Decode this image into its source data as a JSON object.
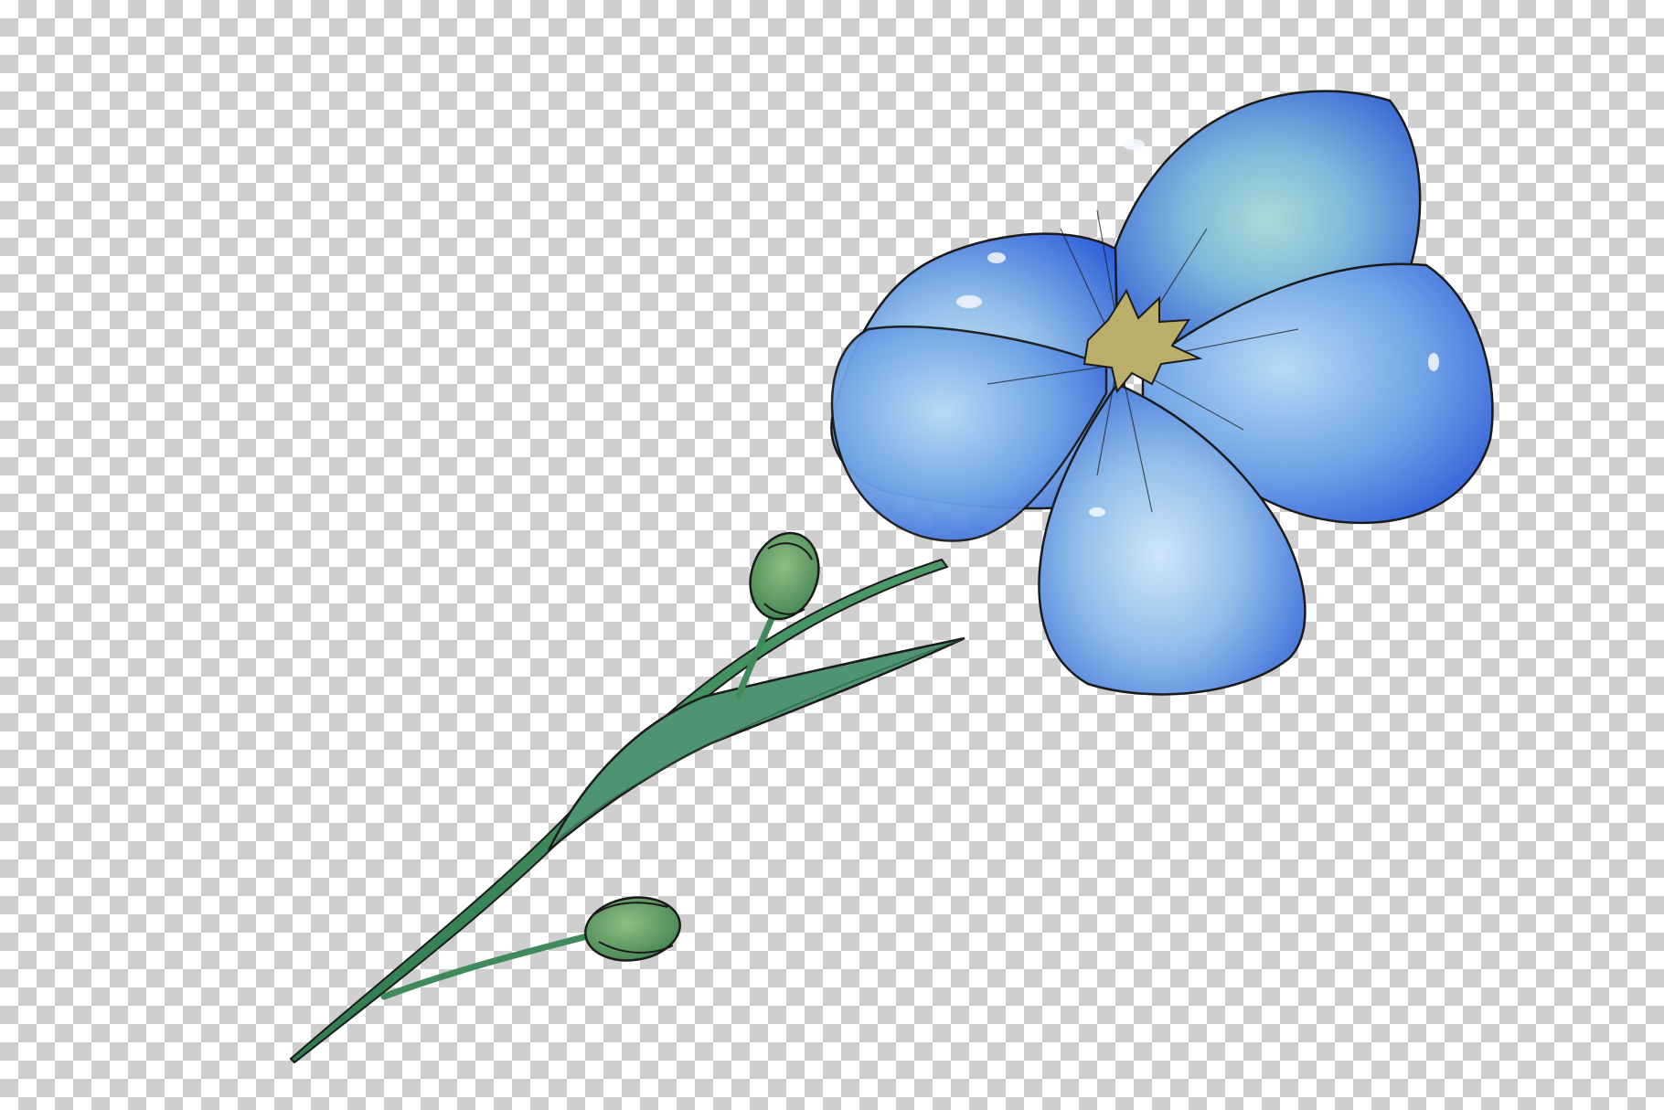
{
  "image": {
    "subject": "watercolor-blue-flax-flower",
    "background": "transparency-checkerboard",
    "colors": {
      "checker_light": "#ffffff",
      "checker_dark": "#cfcfcf",
      "petal_blue": "#3c6fe0",
      "petal_light": "#9cc6f0",
      "petal_teal": "#6fb0b0",
      "center": "#b9ae6a",
      "stem_green": "#3f8a5a",
      "outline": "#1a1a1a"
    },
    "parts": [
      "flower",
      "stem",
      "leaf",
      "bud-upper",
      "bud-lower"
    ]
  }
}
